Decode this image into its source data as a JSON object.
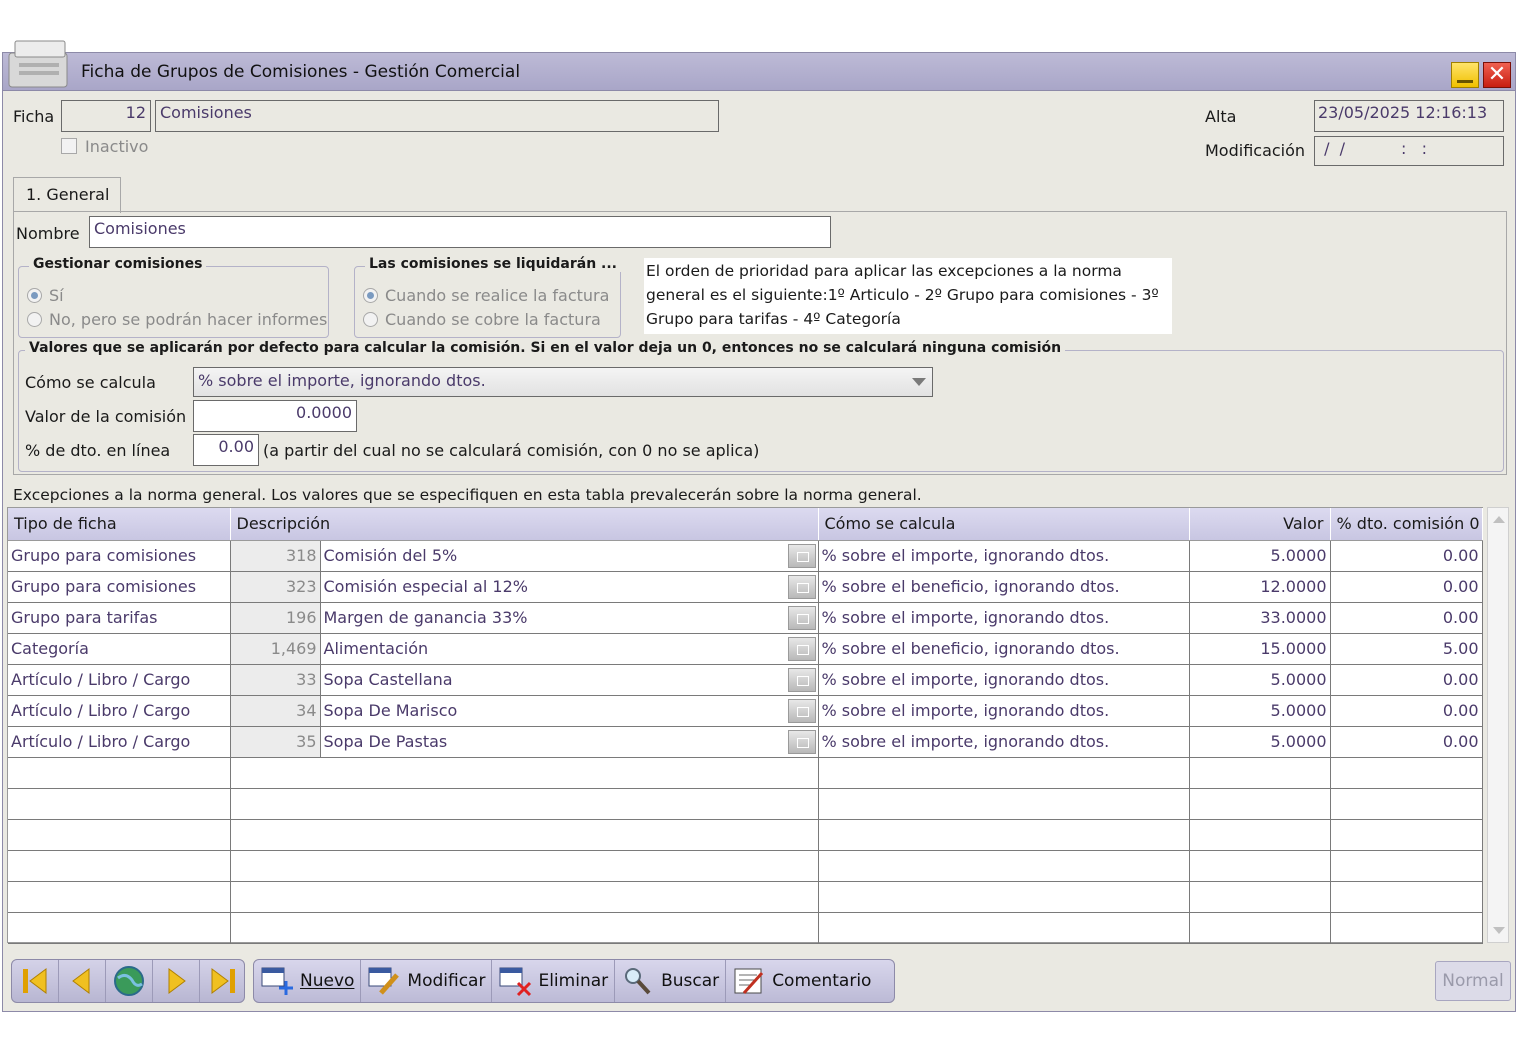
{
  "window": {
    "title": "Ficha de Grupos de Comisiones - Gestión Comercial",
    "close_glyph": "✕"
  },
  "header": {
    "ficha_label": "Ficha",
    "ficha_number": "12",
    "ficha_name": "Comisiones",
    "inactivo_label": "Inactivo",
    "alta_label": "Alta",
    "alta_value": "23/05/2025  12:16:13",
    "modificacion_label": "Modificación",
    "modificacion_value": " /  /           :   :"
  },
  "tabs": [
    {
      "label": "1. General"
    }
  ],
  "general": {
    "nombre_label": "Nombre",
    "nombre_value": "Comisiones",
    "gestionar": {
      "title": "Gestionar comisiones",
      "options": [
        "Sí",
        "No, pero se podrán hacer informes"
      ],
      "selected": 0
    },
    "liquidaran": {
      "title": "Las comisiones se liquidarán ...",
      "options": [
        "Cuando se realice la factura",
        "Cuando se cobre la factura"
      ],
      "selected": 0
    },
    "info_text": "El orden de prioridad para aplicar las excepciones a la norma general es el siguiente:1º Articulo - 2º Grupo para comisiones - 3º Grupo para tarifas - 4º Categoría",
    "defaults": {
      "title": "Valores que se aplicarán por defecto para calcular la comisión. Si en el valor deja un 0, entonces no se calculará ninguna comisión",
      "como_label": "Cómo se calcula",
      "como_value": "% sobre el importe, ignorando dtos.",
      "valor_label": "Valor de la comisión",
      "valor_value": "0.0000",
      "dto_label": "% de dto. en línea",
      "dto_value": "0.00",
      "dto_note": "(a partir del cual no se calculará comisión, con 0 no se aplica)"
    }
  },
  "exceptions": {
    "caption": "Excepciones a la norma general. Los valores que se especifiquen en esta tabla prevalecerán sobre la norma general.",
    "columns": [
      "Tipo de ficha",
      "Descripción",
      "Cómo se calcula",
      "Valor",
      "% dto. comisión 0"
    ],
    "rows": [
      {
        "tipo": "Grupo para comisiones",
        "codigo": "318",
        "descripcion": "Comisión del 5%",
        "como": "% sobre el importe, ignorando dtos.",
        "valor": "5.0000",
        "dto": "0.00"
      },
      {
        "tipo": "Grupo para comisiones",
        "codigo": "323",
        "descripcion": "Comisión especial al 12%",
        "como": "% sobre el beneficio, ignorando dtos.",
        "valor": "12.0000",
        "dto": "0.00"
      },
      {
        "tipo": "Grupo para tarifas",
        "codigo": "196",
        "descripcion": "Margen de ganancia 33%",
        "como": "% sobre el importe, ignorando dtos.",
        "valor": "33.0000",
        "dto": "0.00"
      },
      {
        "tipo": "Categoría",
        "codigo": "1,469",
        "descripcion": "Alimentación",
        "como": "% sobre el beneficio, ignorando dtos.",
        "valor": "15.0000",
        "dto": "5.00"
      },
      {
        "tipo": "Artículo / Libro / Cargo",
        "codigo": "33",
        "descripcion": "Sopa Castellana",
        "como": "% sobre el importe, ignorando dtos.",
        "valor": "5.0000",
        "dto": "0.00"
      },
      {
        "tipo": "Artículo / Libro / Cargo",
        "codigo": "34",
        "descripcion": "Sopa De Marisco",
        "como": "% sobre el importe, ignorando dtos.",
        "valor": "5.0000",
        "dto": "0.00"
      },
      {
        "tipo": "Artículo / Libro / Cargo",
        "codigo": "35",
        "descripcion": "Sopa De Pastas",
        "como": "% sobre el importe, ignorando dtos.",
        "valor": "5.0000",
        "dto": "0.00"
      }
    ],
    "empty_rows": 6
  },
  "toolbar": {
    "nuevo": "Nuevo",
    "modificar": "Modificar",
    "eliminar": "Eliminar",
    "buscar": "Buscar",
    "comentario": "Comentario",
    "mode": "Normal"
  }
}
